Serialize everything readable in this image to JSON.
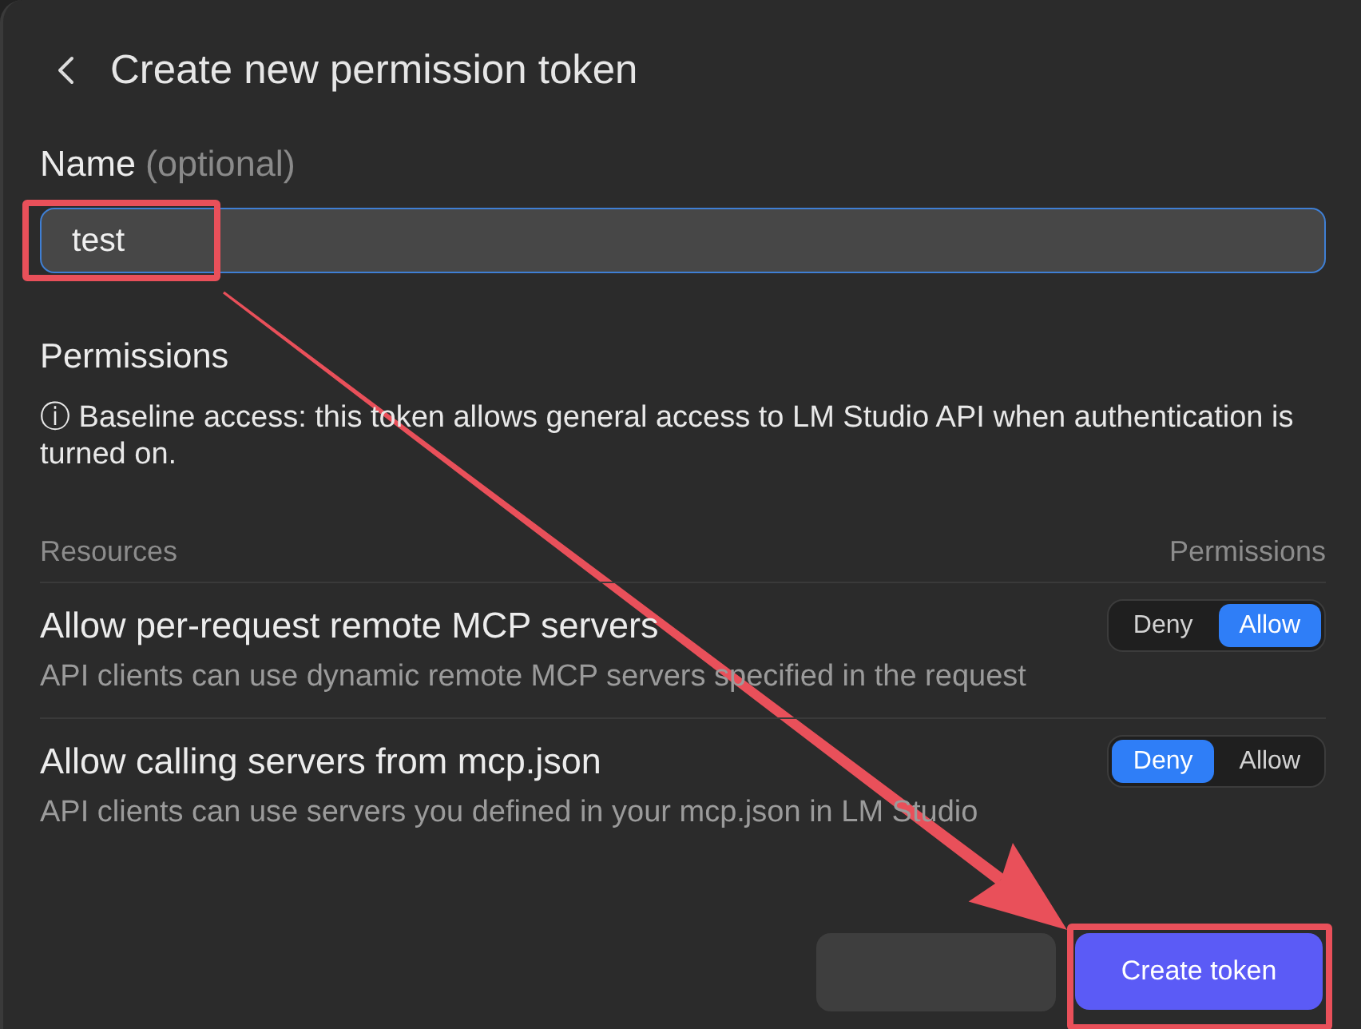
{
  "header": {
    "title": "Create new permission token"
  },
  "name_field": {
    "label": "Name",
    "hint": "(optional)",
    "value": "test",
    "focused": true,
    "highlighted": true
  },
  "permissions": {
    "title": "Permissions",
    "note": "ⓘ Baseline access: this token allows general access to LM Studio API when authentication is turned on.",
    "columns": [
      "Resources",
      "Permissions"
    ],
    "rows": [
      {
        "title": "Allow per-request remote MCP servers",
        "description": "API clients can use dynamic remote MCP servers specified in the request",
        "options": [
          {
            "label": "Deny",
            "selected": false
          },
          {
            "label": "Allow",
            "selected": true
          }
        ]
      },
      {
        "title": "Allow calling servers from mcp.json",
        "description": "API clients can use servers you defined in your mcp.json in LM Studio",
        "options": [
          {
            "label": "Deny",
            "selected": true
          },
          {
            "label": "Allow",
            "selected": false
          }
        ]
      }
    ]
  },
  "buttons": [
    {
      "kind": "secondary",
      "highlighted": false
    },
    {
      "kind": "primary",
      "label": "Create token",
      "highlighted": true
    }
  ],
  "annotation_arrow": true
}
